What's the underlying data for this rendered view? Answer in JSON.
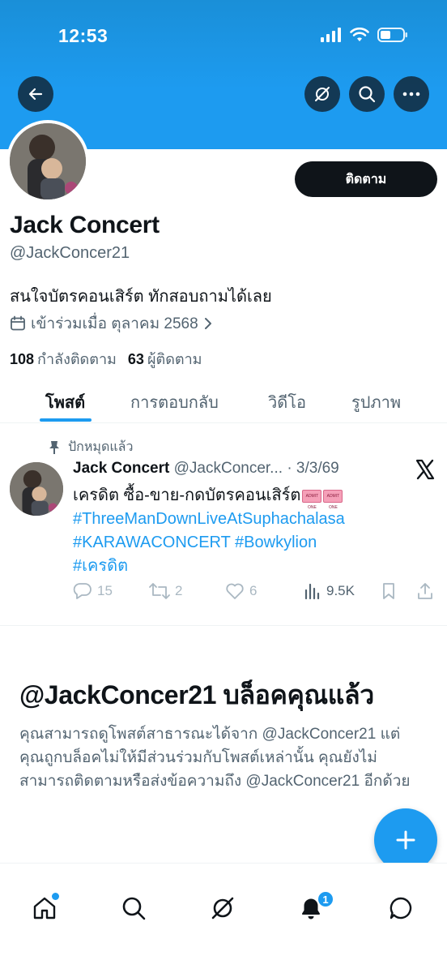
{
  "status_bar": {
    "time": "12:53"
  },
  "header": {
    "back_icon": "arrow-left-icon",
    "actions": [
      "grok-icon",
      "search-icon",
      "more-icon"
    ]
  },
  "profile": {
    "name": "Jack Concert",
    "handle": "@JackConcer21",
    "follow_label": "ติดตาม",
    "bio": "สนใจบัตรคอนเสิร์ต ทักสอบถามได้เลย",
    "joined": "เข้าร่วมเมื่อ ตุลาคม 2568",
    "following_count": "108",
    "following_label": "กำลังติดตาม",
    "followers_count": "63",
    "followers_label": "ผู้ติดตาม"
  },
  "tabs": [
    {
      "label": "โพสต์",
      "active": true
    },
    {
      "label": "การตอบกลับ",
      "active": false
    },
    {
      "label": "วิดีโอ",
      "active": false
    },
    {
      "label": "รูปภาพ",
      "active": false
    }
  ],
  "post": {
    "pinned_label": "ปักหมุดแล้ว",
    "author_name": "Jack Concert",
    "author_handle": "@JackConcer...",
    "date": "· 3/3/69",
    "text_line1": "เครดิต ซื้อ-ขาย-กดบัตรคอนเสิร์ต",
    "hashtags": [
      "#ThreeManDownLiveAtSuphachalasa",
      "#KARAWACONCERT",
      "#Bowkylion",
      "#เครดิต"
    ],
    "replies": "15",
    "reposts": "2",
    "likes": "6",
    "views": "9.5K"
  },
  "blocked": {
    "title": "@JackConcer21 บล็อคคุณแล้ว",
    "description": "คุณสามารถดูโพสต์สาธารณะได้จาก @JackConcer21 แต่คุณถูกบล็อคไม่ให้มีส่วนร่วมกับโพสต์เหล่านั้น คุณยังไม่สามารถติดตามหรือส่งข้อความถึง @JackConcer21 อีกด้วย"
  },
  "bottom_nav": {
    "items": [
      "home-icon",
      "search-icon",
      "grok-icon",
      "notifications-icon",
      "messages-icon"
    ],
    "notification_count": "1"
  },
  "colors": {
    "accent": "#1d9bf0",
    "text": "#0f1419",
    "muted": "#536471"
  }
}
